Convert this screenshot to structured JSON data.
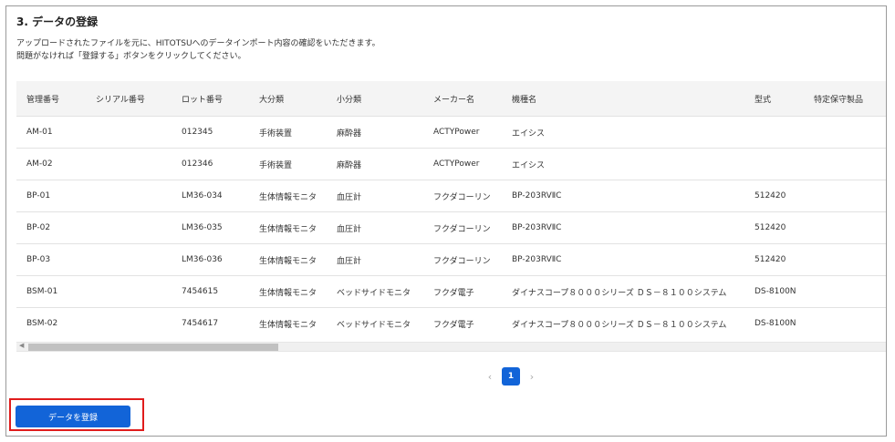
{
  "section": {
    "title": "3. データの登録",
    "description_line1": "アップロードされたファイルを元に、HITOTSUへのデータインポート内容の確認をいただきます。",
    "description_line2": "問題がなければ「登録する」ボタンをクリックしてください。"
  },
  "table": {
    "headers": [
      "管理番号",
      "シリアル番号",
      "ロット番号",
      "大分類",
      "小分類",
      "メーカー名",
      "機種名",
      "型式",
      "特定保守製品"
    ],
    "rows": [
      [
        "AM-01",
        "",
        "012345",
        "手術装置",
        "麻酔器",
        "ACTYPower",
        "エイシス",
        "",
        ""
      ],
      [
        "AM-02",
        "",
        "012346",
        "手術装置",
        "麻酔器",
        "ACTYPower",
        "エイシス",
        "",
        ""
      ],
      [
        "BP-01",
        "",
        "LM36-034",
        "生体情報モニタ",
        "血圧計",
        "フクダコーリン",
        "BP-203RVⅡC",
        "512420",
        ""
      ],
      [
        "BP-02",
        "",
        "LM36-035",
        "生体情報モニタ",
        "血圧計",
        "フクダコーリン",
        "BP-203RVⅡC",
        "512420",
        ""
      ],
      [
        "BP-03",
        "",
        "LM36-036",
        "生体情報モニタ",
        "血圧計",
        "フクダコーリン",
        "BP-203RVⅡC",
        "512420",
        ""
      ],
      [
        "BSM-01",
        "",
        "7454615",
        "生体情報モニタ",
        "ベッドサイドモニタ",
        "フクダ電子",
        "ダイナスコープ８０００シリーズ ＤＳ－８１００システム",
        "DS-8100N",
        ""
      ],
      [
        "BSM-02",
        "",
        "7454617",
        "生体情報モニタ",
        "ベッドサイドモニタ",
        "フクダ電子",
        "ダイナスコープ８０００シリーズ ＤＳ－８１００システム",
        "DS-8100N",
        ""
      ]
    ]
  },
  "pagination": {
    "prev": "‹",
    "current": "1",
    "next": "›"
  },
  "actions": {
    "register_label": "データを登録"
  },
  "colors": {
    "primary": "#1264d8",
    "highlight": "#e01c1c"
  }
}
